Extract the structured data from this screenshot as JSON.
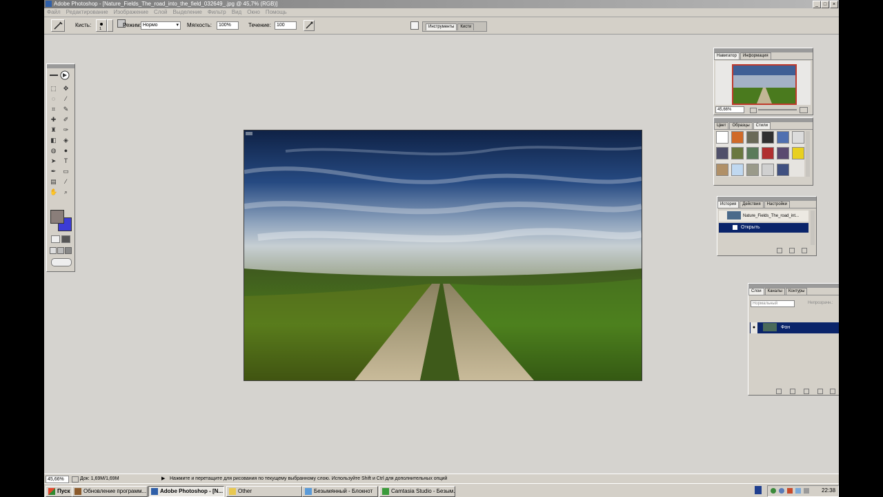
{
  "window": {
    "title": "Adobe Photoshop - [Nature_Fields_The_road_into_the_field_032649_.jpg @ 45,7% (RGB)]"
  },
  "menu": [
    "Файл",
    "Редактирование",
    "Изображение",
    "Слой",
    "Выделение",
    "Фильтр",
    "Вид",
    "Окно",
    "Помощь"
  ],
  "options": {
    "brush_label": "Кисть:",
    "mode_label": "Режим:",
    "mode_value": "Нормо",
    "opacity_label": "Мягкость:",
    "opacity_value": "100%",
    "flow_label": "Течение:",
    "flow_value": "100",
    "well_tabs": [
      "Инструменты",
      "Кисти"
    ]
  },
  "colors": {
    "foreground": "#8a7e7a",
    "background": "#3c3cd6",
    "selection": "#0a246a"
  },
  "navigator": {
    "tabs": [
      "Навигатор",
      "Информация"
    ],
    "zoom": "45,66%"
  },
  "styles": {
    "tabs": [
      "Цвет",
      "Образцы",
      "Стили"
    ],
    "swatches": [
      "#ffffff",
      "#d06a28",
      "#6a6a58",
      "#303030",
      "#5070b0",
      "#dcdcdc",
      "#50506a",
      "#6a7840",
      "#5a7a5a",
      "#b03030",
      "#5a4a70",
      "#e8d020",
      "#b09068",
      "#c0d8f0",
      "#9a9a8a",
      "#d0d0d0",
      "#405080"
    ]
  },
  "history": {
    "tabs": [
      "История",
      "Действия",
      "Настройки"
    ],
    "snapshot": "Nature_Fields_The_road_int...",
    "items": [
      "Открыть"
    ]
  },
  "layers": {
    "tabs": [
      "Слои",
      "Каналы",
      "Контуры"
    ],
    "blend": "Нормальный",
    "opacity_label": "Непрозрачн.:",
    "layer_name": "Фон"
  },
  "status": {
    "zoom": "45,66%",
    "doc": "Док: 1,69M/1,69M",
    "hint": "Нажмите и перетащите для рисования по текущему выбранному слою. Используйте Shift и Ctrl для дополнительных опций"
  },
  "taskbar": {
    "start": "Пуск",
    "buttons": [
      {
        "label": "Обновление программ..."
      },
      {
        "label": "Adobe Photoshop - [N..."
      },
      {
        "label": "Other"
      },
      {
        "label": "Безымянный - Блокнот"
      },
      {
        "label": "Camtasia Studio - Безым..."
      }
    ],
    "clock": "22:38"
  }
}
